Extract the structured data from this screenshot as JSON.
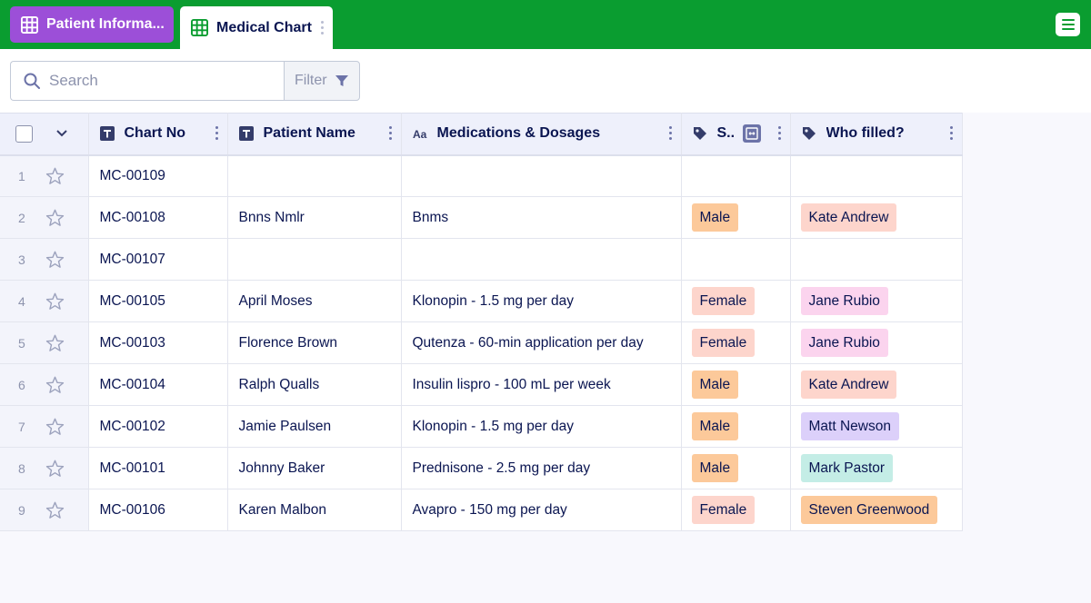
{
  "tabs": [
    {
      "label": "Patient Informa...",
      "active": false
    },
    {
      "label": "Medical Chart",
      "active": true
    }
  ],
  "search": {
    "placeholder": "Search",
    "value": ""
  },
  "filter": {
    "label": "Filter"
  },
  "columns": [
    {
      "label": "Chart No",
      "type_icon": "text-type-icon"
    },
    {
      "label": "Patient Name",
      "type_icon": "text-type-icon"
    },
    {
      "label": "Medications & Dosages",
      "type_icon": "long-text-type-icon"
    },
    {
      "label": "S..",
      "type_icon": "tag-icon"
    },
    {
      "label": "Who filled?",
      "type_icon": "tag-icon"
    }
  ],
  "rows": [
    {
      "num": "1",
      "chart_no": "MC-00109",
      "patient": "",
      "medication": "",
      "sex": "",
      "filled_by": ""
    },
    {
      "num": "2",
      "chart_no": "MC-00108",
      "patient": "Bnns Nmlr",
      "medication": "Bnms",
      "sex": "Male",
      "filled_by": "Kate Andrew"
    },
    {
      "num": "3",
      "chart_no": "MC-00107",
      "patient": "",
      "medication": "",
      "sex": "",
      "filled_by": ""
    },
    {
      "num": "4",
      "chart_no": "MC-00105",
      "patient": "April Moses",
      "medication": "Klonopin - 1.5 mg per day",
      "sex": "Female",
      "filled_by": "Jane Rubio"
    },
    {
      "num": "5",
      "chart_no": "MC-00103",
      "patient": "Florence Brown",
      "medication": "Qutenza - 60-min application per day",
      "sex": "Female",
      "filled_by": "Jane Rubio"
    },
    {
      "num": "6",
      "chart_no": "MC-00104",
      "patient": "Ralph Qualls",
      "medication": "Insulin lispro - 100 mL per week",
      "sex": "Male",
      "filled_by": "Kate Andrew"
    },
    {
      "num": "7",
      "chart_no": "MC-00102",
      "patient": "Jamie Paulsen",
      "medication": "Klonopin - 1.5 mg per day",
      "sex": "Male",
      "filled_by": "Matt Newson"
    },
    {
      "num": "8",
      "chart_no": "MC-00101",
      "patient": "Johnny Baker",
      "medication": "Prednisone - 2.5 mg per day",
      "sex": "Male",
      "filled_by": "Mark Pastor"
    },
    {
      "num": "9",
      "chart_no": "MC-00106",
      "patient": "Karen Malbon",
      "medication": "Avapro - 150 mg per day",
      "sex": "Female",
      "filled_by": "Steven Greenwood"
    }
  ],
  "tag_colors": {
    "Male": "#fcc99a",
    "Female": "#fdd5cc",
    "Kate Andrew": "#fdd5cc",
    "Jane Rubio": "#fbd4ee",
    "Matt Newson": "#dcd0fa",
    "Mark Pastor": "#c4ede6",
    "Steven Greenwood": "#fcc99a"
  },
  "colors": {
    "topbar": "#0a9d30",
    "inactive_tab": "#9c4fd8",
    "header_bg": "#eef0fb"
  }
}
